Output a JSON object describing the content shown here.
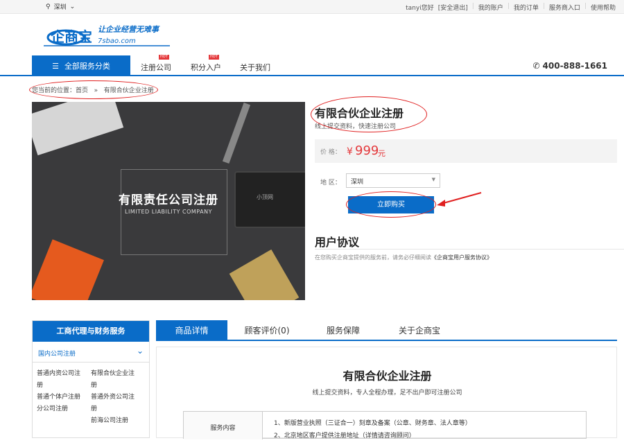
{
  "topbar": {
    "city": "深圳",
    "links": [
      "tanyi您好",
      "[安全退出]",
      "我的账户",
      "我的订单",
      "服务商入口",
      "使用帮助"
    ]
  },
  "logo": {
    "name": "企商宝",
    "slogan": "让企业经营无难事",
    "domain": "7sbao.com"
  },
  "nav": {
    "all_categories": "全部服务分类",
    "items": [
      {
        "label": "注册公司",
        "hot": "HOT"
      },
      {
        "label": "积分入户",
        "hot": "HOT"
      },
      {
        "label": "关于我们",
        "hot": ""
      }
    ],
    "phone": "400-888-1661"
  },
  "breadcrumb": {
    "prefix": "您当前的位置：",
    "home": "首页",
    "sep": "»",
    "current": "有限合伙企业注册"
  },
  "hero": {
    "title": "有限责任公司注册",
    "subtitle": "LIMITED LIABILITY COMPANY",
    "device_text": "小顶网"
  },
  "product": {
    "title": "有限合伙企业注册",
    "subtitle": "线上提交资料，快速注册公司",
    "price_label": "价    格：",
    "currency": "¥",
    "price": "999",
    "unit": "元",
    "region_label": "地    区：",
    "region_value": "深圳",
    "buy_label": "立即购买"
  },
  "agreement": {
    "title": "用户协议",
    "text": "在您购买企商宝提供的服务前，请务必仔细阅读",
    "link": "《企商宝用户服务协议》"
  },
  "sidebar": {
    "title": "工商代理与财务服务",
    "group": "国内公司注册",
    "col1": [
      "普通内资公司注",
      "册",
      "普通个体户注册",
      "",
      "分公司注册"
    ],
    "col2": [
      "有限合伙企业注",
      "册",
      "普通外资公司注",
      "册",
      "前海公司注册"
    ]
  },
  "tabs": [
    "商品详情",
    "顾客评价(0)",
    "服务保障",
    "关于企商宝"
  ],
  "detail": {
    "title": "有限合伙企业注册",
    "subtitle": "线上提交资料，专人全程办理，足不出户即可注册公司",
    "row_label": "服务内容",
    "row_items": [
      "1、新版营业执照（三证合一）刻章及备案（公章、财务章、法人章等）",
      "2、北京地区客户提供注册地址（详情请咨询顾问）"
    ]
  },
  "colors": {
    "primary": "#0a6cc8",
    "price": "#e4393c",
    "annotation": "#e02020"
  }
}
